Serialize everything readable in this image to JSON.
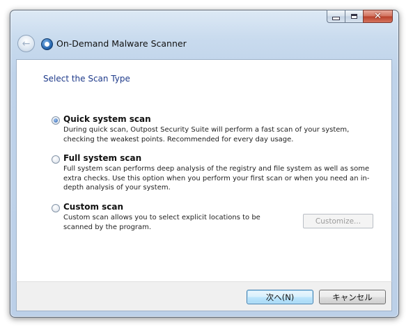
{
  "window": {
    "title": "On-Demand Malware Scanner",
    "controls": {
      "minimize": "minimize",
      "maximize": "maximize",
      "close": "✕"
    }
  },
  "page": {
    "heading": "Select the Scan Type",
    "options": [
      {
        "label": "Quick system scan",
        "description": "During quick scan, Outpost Security Suite will perform a fast scan of your system, checking the weakest points. Recommended for every day usage.",
        "checked": true
      },
      {
        "label": "Full system scan",
        "description": "Full system scan performs deep analysis of the registry and file system as well as some extra checks. Use this option when you perform your first scan or when you need an in-depth analysis of your system.",
        "checked": false
      },
      {
        "label": "Custom scan",
        "description": "Custom scan allows you to select explicit locations to be scanned by the program.",
        "checked": false
      }
    ],
    "customize_label": "Customize..."
  },
  "footer": {
    "next_label": "次へ(N)",
    "cancel_label": "キャンセル"
  },
  "icons": {
    "back": "back-arrow-icon",
    "app": "outpost-shield-icon"
  }
}
